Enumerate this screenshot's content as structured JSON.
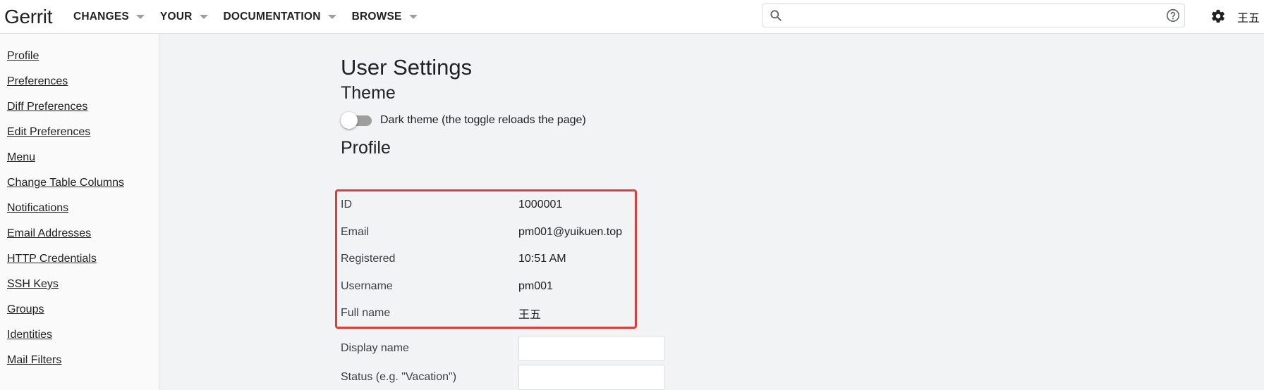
{
  "header": {
    "logo": "Gerrit",
    "nav": [
      {
        "label": "CHANGES"
      },
      {
        "label": "YOUR"
      },
      {
        "label": "DOCUMENTATION"
      },
      {
        "label": "BROWSE"
      }
    ],
    "search": {
      "value": "",
      "placeholder": ""
    },
    "user_name": "王五"
  },
  "sidebar": {
    "items": [
      {
        "label": "Profile"
      },
      {
        "label": "Preferences"
      },
      {
        "label": "Diff Preferences"
      },
      {
        "label": "Edit Preferences"
      },
      {
        "label": "Menu"
      },
      {
        "label": "Change Table Columns"
      },
      {
        "label": "Notifications"
      },
      {
        "label": "Email Addresses"
      },
      {
        "label": "HTTP Credentials"
      },
      {
        "label": "SSH Keys"
      },
      {
        "label": "Groups"
      },
      {
        "label": "Identities"
      },
      {
        "label": "Mail Filters"
      }
    ]
  },
  "main": {
    "title": "User Settings",
    "theme": {
      "heading": "Theme",
      "dark_theme_label": "Dark theme (the toggle reloads the page)",
      "dark_theme_on": false
    },
    "profile": {
      "heading": "Profile",
      "fields": [
        {
          "label": "ID",
          "value": "1000001"
        },
        {
          "label": "Email",
          "value": "pm001@yuikuen.top"
        },
        {
          "label": "Registered",
          "value": "10:51 AM"
        },
        {
          "label": "Username",
          "value": "pm001"
        },
        {
          "label": "Full name",
          "value": "王五"
        }
      ],
      "editable": [
        {
          "label": "Display name",
          "value": ""
        },
        {
          "label": "Status (e.g. \"Vacation\")",
          "value": ""
        }
      ]
    }
  },
  "colors": {
    "highlight": "#e53935",
    "background": "#f1f3f4",
    "sidebar_bg": "#fafafa"
  }
}
